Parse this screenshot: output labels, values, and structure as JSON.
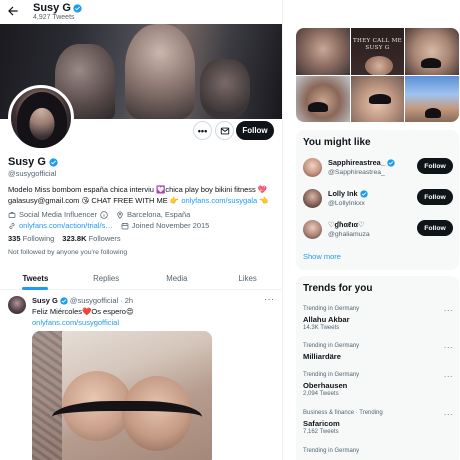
{
  "colors": {
    "accent": "#1d9bf0",
    "text": "#0f1419",
    "muted": "#536471",
    "follow_bg": "#0f1419",
    "card_bg": "#f7f9f9"
  },
  "header": {
    "name": "Susy G",
    "tweet_count": "4,927 Tweets",
    "back_icon": "arrow-left-icon"
  },
  "profile": {
    "name": "Susy G",
    "handle": "@susygofficial",
    "follow_label": "Follow",
    "more_icon": "more-icon",
    "message_icon": "mail-icon",
    "bio_line1": "Modelo Miss bombom españa chica interviu",
    "bio_line1b": "chica play boy bikini fitness",
    "bio_line2_start": "galasusy@gmail.com",
    "bio_line2_mid": "CHAT FREE WITH ME",
    "bio_line2_link": "onlyfans.com/susygala",
    "category": "Social Media Influencer",
    "location": "Barcelona, España",
    "website": "onlyfans.com/action/trial/s…",
    "joined": "Joined November 2015",
    "following_count": "335",
    "following_label": "Following",
    "followers_count": "323.8K",
    "followers_label": "Followers",
    "followed_by": "Not followed by anyone you're following"
  },
  "tabs": [
    {
      "label": "Tweets",
      "active": true
    },
    {
      "label": "Replies",
      "active": false
    },
    {
      "label": "Media",
      "active": false
    },
    {
      "label": "Likes",
      "active": false
    }
  ],
  "tweet": {
    "name": "Susy G",
    "handle": "@susygofficial",
    "sep": "·",
    "time": "2h",
    "text_line1": "Feliz Miércoles",
    "text_line1b": "Os espero",
    "text_line2": "onlyfans.com/susygofficial",
    "more": "···"
  },
  "media_grid": {
    "overlay_text_1": "THEY CALL ME",
    "overlay_text_2": "SUSY G"
  },
  "who_to_follow": {
    "title": "You might like",
    "items": [
      {
        "name": "Sapphireastrea_",
        "handle": "@Sapphireastrea_",
        "verified": true,
        "button": "Follow"
      },
      {
        "name": "Lolly Ink",
        "handle": "@LollyInkxx",
        "verified": true,
        "button": "Follow"
      },
      {
        "name": "♡ɠɦαℓια♡",
        "handle": "@ghaliamuza",
        "verified": false,
        "button": "Follow"
      }
    ],
    "show_more": "Show more"
  },
  "trends": {
    "title": "Trends for you",
    "items": [
      {
        "context": "Trending in Germany",
        "name": "Allahu Akbar",
        "count": "14.3K Tweets"
      },
      {
        "context": "Trending in Germany",
        "name": "Milliardäre",
        "count": ""
      },
      {
        "context": "Trending in Germany",
        "name": "Oberhausen",
        "count": "2,094 Tweets"
      },
      {
        "context": "Business & finance · Trending",
        "name": "Safaricom",
        "count": "7,162 Tweets"
      },
      {
        "context": "Trending in Germany",
        "name": "",
        "count": ""
      }
    ],
    "more": "···"
  }
}
